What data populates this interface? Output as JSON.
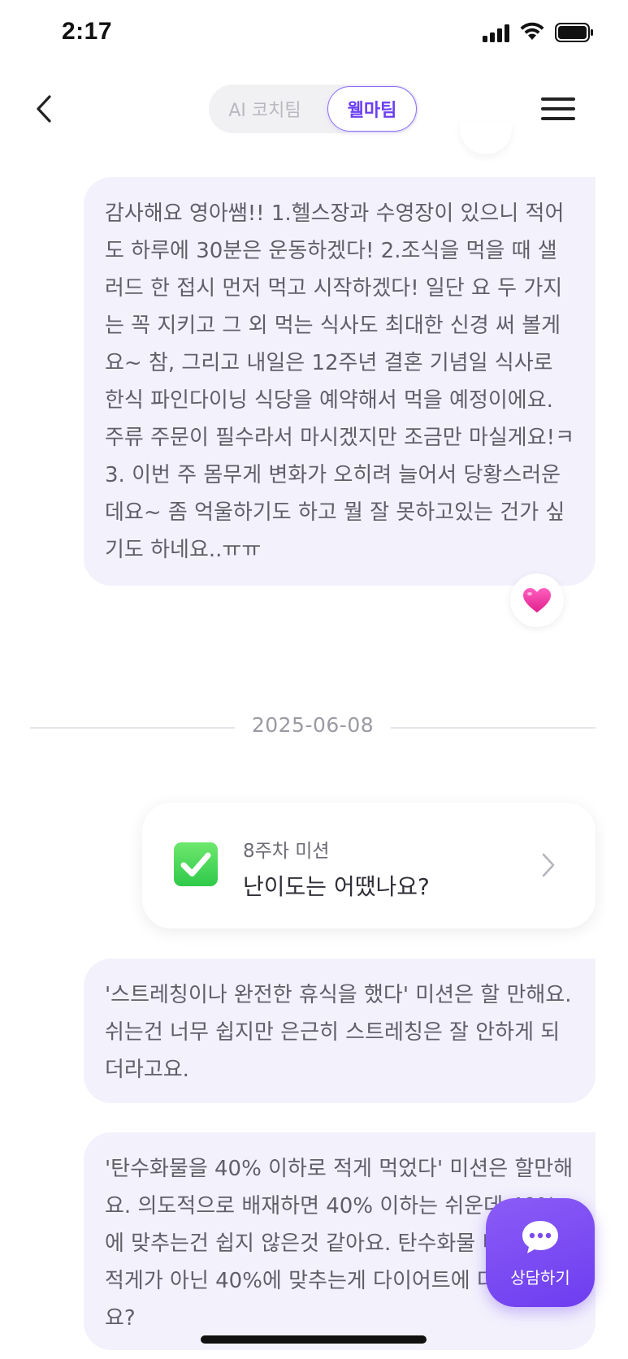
{
  "status_bar": {
    "time": "2:17"
  },
  "header": {
    "tabs": [
      {
        "label": "AI 코치팀",
        "active": false
      },
      {
        "label": "웰마팀",
        "active": true
      }
    ]
  },
  "messages": [
    {
      "text": "감사해요 영아쌤!! 1.헬스장과 수영장이 있으니 적어도 하루에 30분은 운동하겠다! 2.조식을 먹을 때 샐러드 한 접시 먼저 먹고 시작하겠다! 일단 요 두 가지는 꼭 지키고 그 외 먹는 식사도 최대한 신경 써 볼게요~ 참, 그리고 내일은 12주년 결혼 기념일 식사로 한식 파인다이닝 식당을 예약해서 먹을 예정이에요. 주류 주문이 필수라서 마시겠지만 조금만 마실게요!ㅋ 3. 이번 주 몸무게 변화가 오히려 늘어서 당황스러운데요~ 좀 억울하기도 하고 뭘 잘 못하고있는 건가 싶기도 하네요..ㅠㅠ",
      "reaction": "heart"
    },
    {
      "text": "'스트레칭이나 완전한 휴식을 했다' 미션은 할 만해요. 쉬는건 너무 쉽지만 은근히 스트레칭은 잘 안하게 되더라고요."
    },
    {
      "text": "'탄수화물을 40% 이하로 적게 먹었다' 미션은 할만해요. 의도적으로 배재하면 40% 이하는 쉬운데 40%에 맞추는건 쉽지 않은것 같아요. 탄수화물 비율을 더 적게가 아닌 40%에 맞추는게 다이어트에 더 좋은가요?"
    }
  ],
  "date_divider": "2025-06-08",
  "mission_card": {
    "week_label": "8주차 미션",
    "title": "난이도는 어땠나요?"
  },
  "counsel_button": {
    "label": "상담하기"
  },
  "colors": {
    "accent": "#6d3df0",
    "bubble": "#f3f1fc"
  }
}
